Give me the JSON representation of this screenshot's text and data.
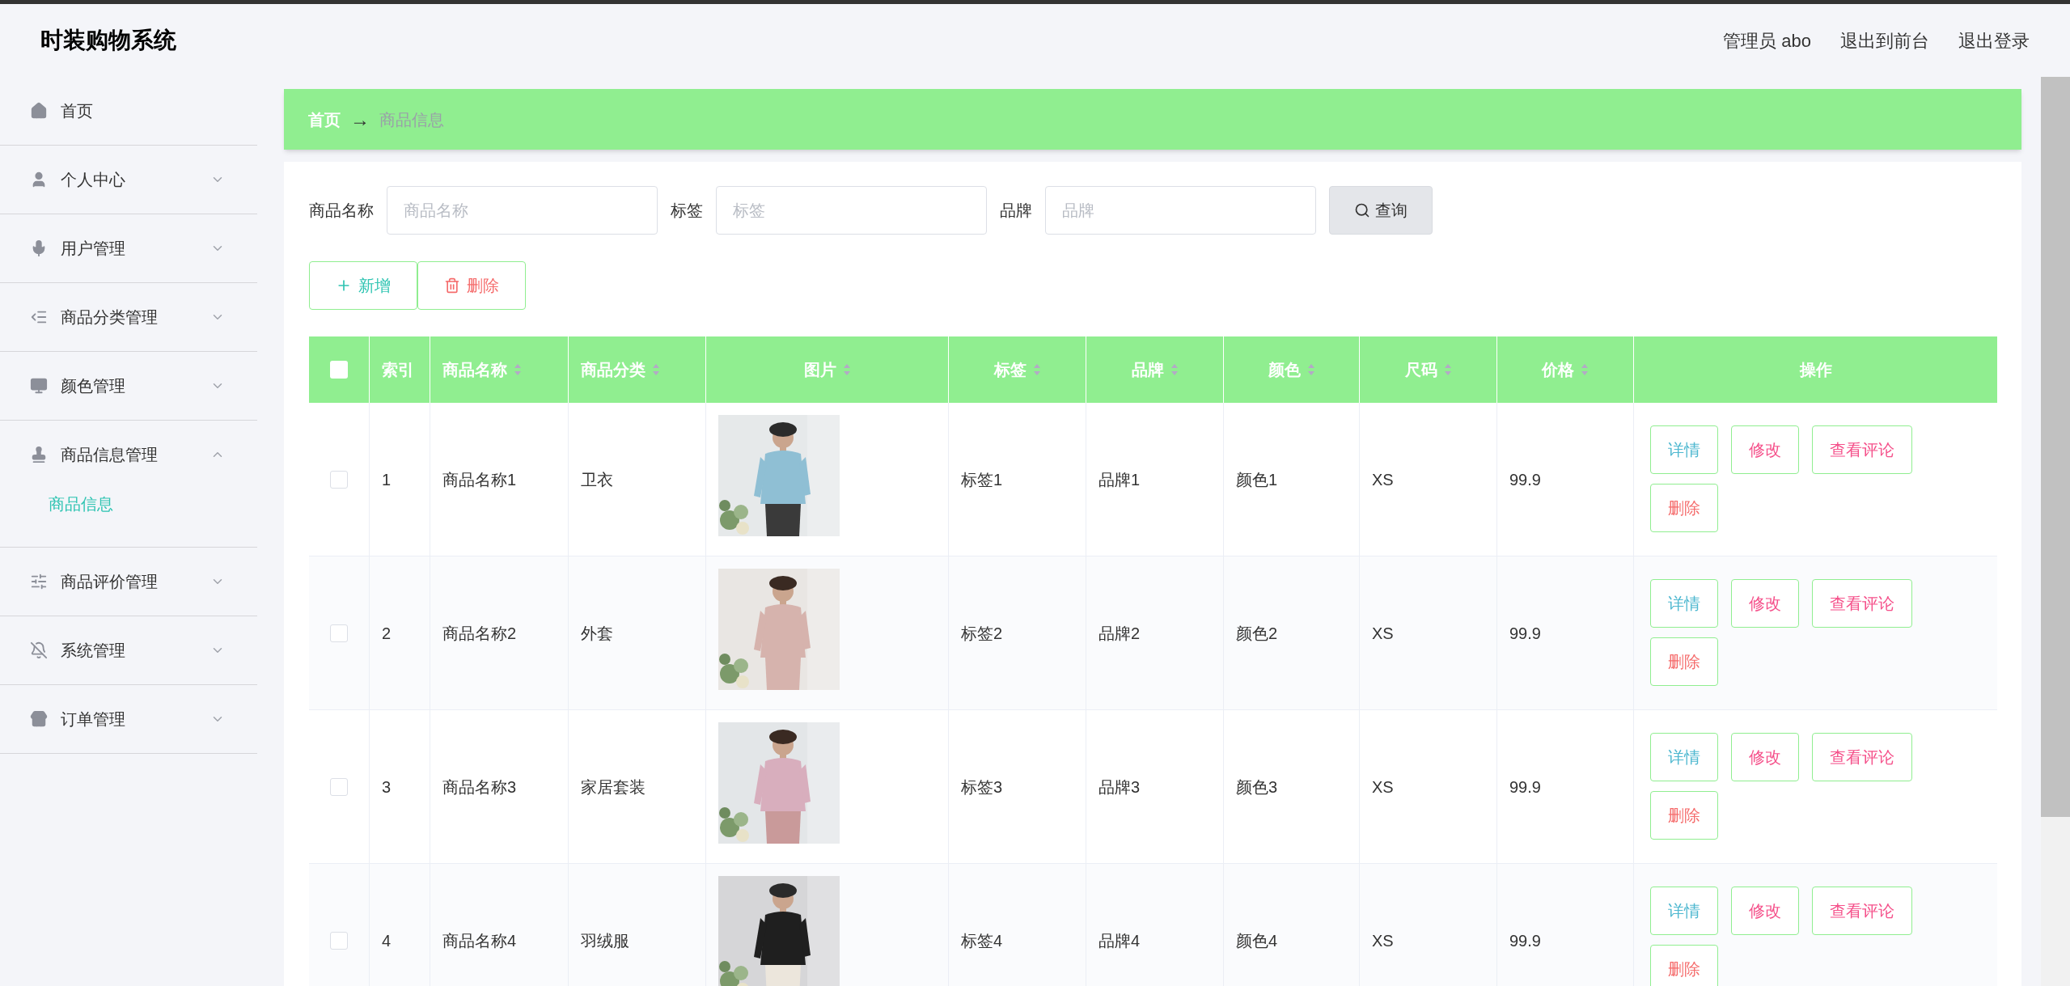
{
  "header": {
    "title": "时装购物系统",
    "user": "管理员 abo",
    "links": [
      "退出到前台",
      "退出登录"
    ]
  },
  "sidebar": {
    "items": [
      {
        "label": "首页",
        "kind": "link"
      },
      {
        "label": "个人中心",
        "kind": "menu",
        "expanded": false
      },
      {
        "label": "用户管理",
        "kind": "menu",
        "expanded": false
      },
      {
        "label": "商品分类管理",
        "kind": "menu",
        "expanded": false
      },
      {
        "label": "颜色管理",
        "kind": "menu",
        "expanded": false
      },
      {
        "label": "商品信息管理",
        "kind": "menu",
        "expanded": true,
        "children": [
          {
            "label": "商品信息",
            "selected": true
          }
        ]
      },
      {
        "label": "商品评价管理",
        "kind": "menu",
        "expanded": false
      },
      {
        "label": "系统管理",
        "kind": "menu",
        "expanded": false
      },
      {
        "label": "订单管理",
        "kind": "menu",
        "expanded": false
      }
    ]
  },
  "breadcrumb": {
    "items": [
      "首页",
      "商品信息"
    ],
    "separator": "→"
  },
  "search": {
    "fields": [
      {
        "label": "商品名称",
        "placeholder": "商品名称"
      },
      {
        "label": "标签",
        "placeholder": "标签"
      },
      {
        "label": "品牌",
        "placeholder": "品牌"
      }
    ],
    "button": "查询"
  },
  "actions": [
    {
      "label": "新增",
      "kind": "add"
    },
    {
      "label": "删除",
      "kind": "delete"
    }
  ],
  "table": {
    "select_all": {
      "checked": false
    },
    "columns": [
      {
        "label": "索引",
        "sortable": false
      },
      {
        "label": "商品名称",
        "sortable": true
      },
      {
        "label": "商品分类",
        "sortable": true
      },
      {
        "label": "图片",
        "sortable": true
      },
      {
        "label": "标签",
        "sortable": true
      },
      {
        "label": "品牌",
        "sortable": true
      },
      {
        "label": "颜色",
        "sortable": true
      },
      {
        "label": "尺码",
        "sortable": true
      },
      {
        "label": "价格",
        "sortable": true
      },
      {
        "label": "操作",
        "sortable": false
      }
    ],
    "rows": [
      {
        "checked": false,
        "index": "1",
        "name": "商品名称1",
        "category": "卫衣",
        "tag": "标签1",
        "brand": "品牌1",
        "color_name": "颜色1",
        "size": "XS",
        "price": "99.9",
        "actions": [
          {
            "label": "详情",
            "kind": "detail"
          },
          {
            "label": "修改",
            "kind": "edit"
          },
          {
            "label": "查看评论",
            "kind": "comments"
          },
          {
            "label": "删除",
            "kind": "delete"
          }
        ]
      },
      {
        "checked": false,
        "index": "2",
        "name": "商品名称2",
        "category": "外套",
        "tag": "标签2",
        "brand": "品牌2",
        "color_name": "颜色2",
        "size": "XS",
        "price": "99.9",
        "actions": [
          {
            "label": "详情",
            "kind": "detail"
          },
          {
            "label": "修改",
            "kind": "edit"
          },
          {
            "label": "查看评论",
            "kind": "comments"
          },
          {
            "label": "删除",
            "kind": "delete"
          }
        ]
      },
      {
        "checked": false,
        "index": "3",
        "name": "商品名称3",
        "category": "家居套装",
        "tag": "标签3",
        "brand": "品牌3",
        "color_name": "颜色3",
        "size": "XS",
        "price": "99.9",
        "actions": [
          {
            "label": "详情",
            "kind": "detail"
          },
          {
            "label": "修改",
            "kind": "edit"
          },
          {
            "label": "查看评论",
            "kind": "comments"
          },
          {
            "label": "删除",
            "kind": "delete"
          }
        ]
      },
      {
        "checked": false,
        "index": "4",
        "name": "商品名称4",
        "category": "羽绒服",
        "tag": "标签4",
        "brand": "品牌4",
        "color_name": "颜色4",
        "size": "XS",
        "price": "99.9",
        "actions": [
          {
            "label": "详情",
            "kind": "detail"
          },
          {
            "label": "修改",
            "kind": "edit"
          },
          {
            "label": "查看评论",
            "kind": "comments"
          },
          {
            "label": "删除",
            "kind": "delete"
          }
        ]
      }
    ]
  }
}
